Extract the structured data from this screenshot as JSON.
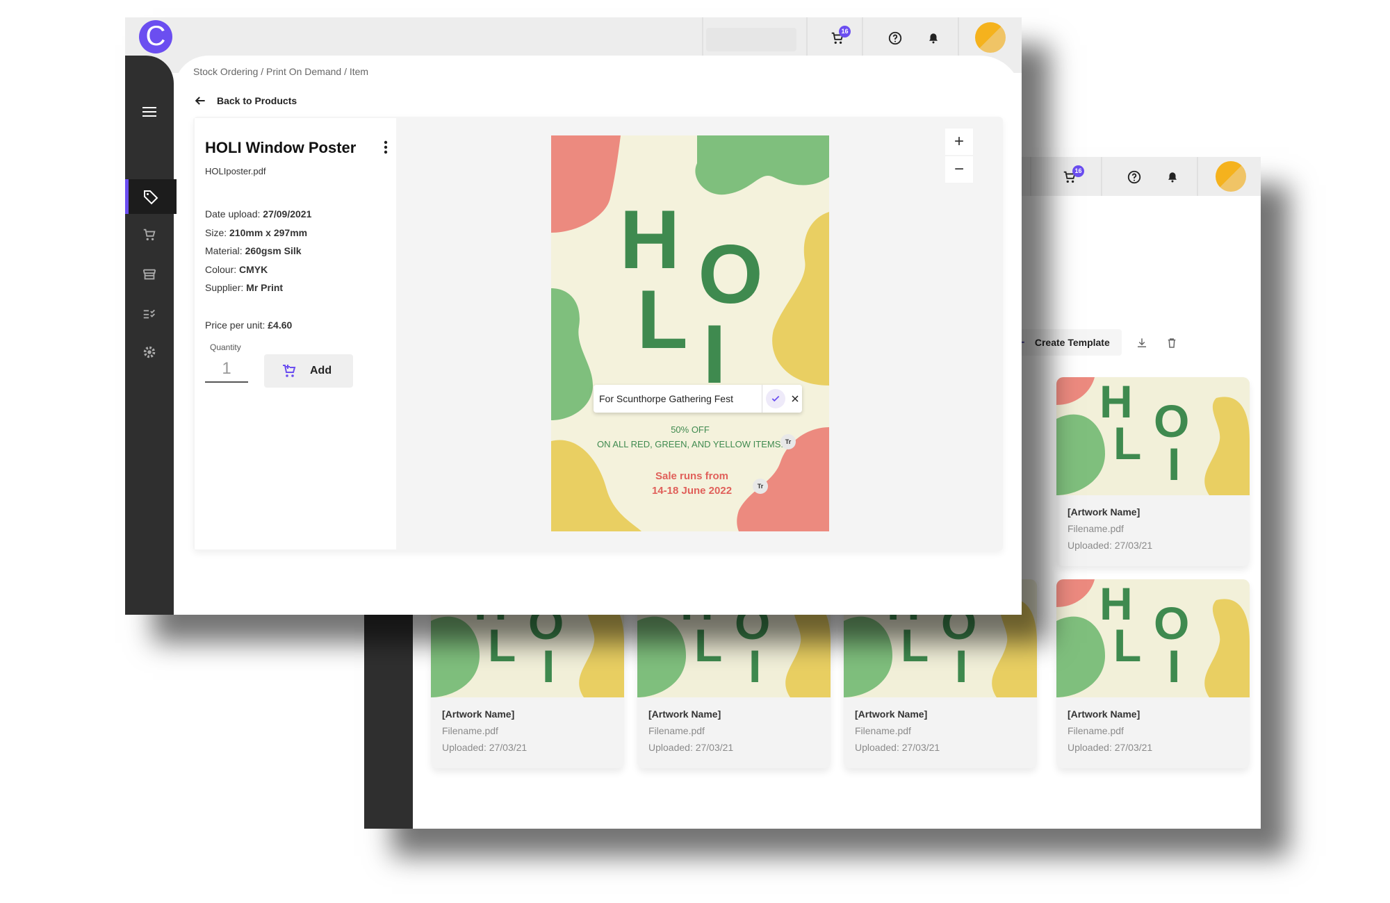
{
  "colors": {
    "accent": "#6b4ef0",
    "sidebar": "#2f2f2f",
    "poster_green": "#3f8a4f",
    "poster_red": "#e0605a",
    "blob_green": "#7fbf7d",
    "blob_red": "#ec8a7f",
    "blob_yellow": "#e9cf62"
  },
  "back_window": {
    "cart_badge": "16",
    "create_template_label": "Create Template",
    "icons": [
      "cart-icon",
      "help-icon",
      "bell-icon",
      "download-icon",
      "trash-icon",
      "plus-icon"
    ],
    "cards": [
      {
        "name": "[Artwork Name]",
        "filename": "Filename.pdf",
        "uploaded": "Uploaded: 27/03/21"
      },
      {
        "name": "[Artwork Name]",
        "filename": "Filename.pdf",
        "uploaded": "Uploaded: 27/03/21"
      },
      {
        "name": "[Artwork Name]",
        "filename": "Filename.pdf",
        "uploaded": "Uploaded: 27/03/21"
      },
      {
        "name": "[Artwork Name]",
        "filename": "Filename.pdf",
        "uploaded": "Uploaded: 27/03/21"
      },
      {
        "name": "[Artwork Name]",
        "filename": "Filename.pdf",
        "uploaded": "Uploaded: 27/03/21"
      }
    ]
  },
  "front_window": {
    "logo_letter": "C",
    "cart_badge": "16",
    "breadcrumb": "Stock Ordering / Print On Demand / Item",
    "back_label": "Back to Products",
    "product": {
      "title": "HOLI Window Poster",
      "filename": "HOLIposter.pdf",
      "date_label": "Date upload:",
      "date_value": "27/09/2021",
      "size_label": "Size:",
      "size_value": "210mm x 297mm",
      "material_label": "Material:",
      "material_value": "260gsm Silk",
      "colour_label": "Colour:",
      "colour_value": "CMYK",
      "supplier_label": "Supplier:",
      "supplier_value": "Mr Print",
      "price_label": "Price per unit:",
      "price_value": "£4.60",
      "quantity_label": "Quantity",
      "quantity_value": "1",
      "add_label": "Add"
    },
    "zoom": {
      "in": "+",
      "out": "−"
    },
    "poster": {
      "letters": [
        "H",
        "O",
        "L",
        "I"
      ],
      "edit_value": "For Scunthorpe Gathering Fest",
      "offer_line1": "50% OFF",
      "offer_line2": "ON ALL RED, GREEN, AND YELLOW ITEMS!",
      "sale_line1": "Sale runs from",
      "sale_line2": "14-18 June 2022",
      "text_tool": "Tr"
    }
  }
}
